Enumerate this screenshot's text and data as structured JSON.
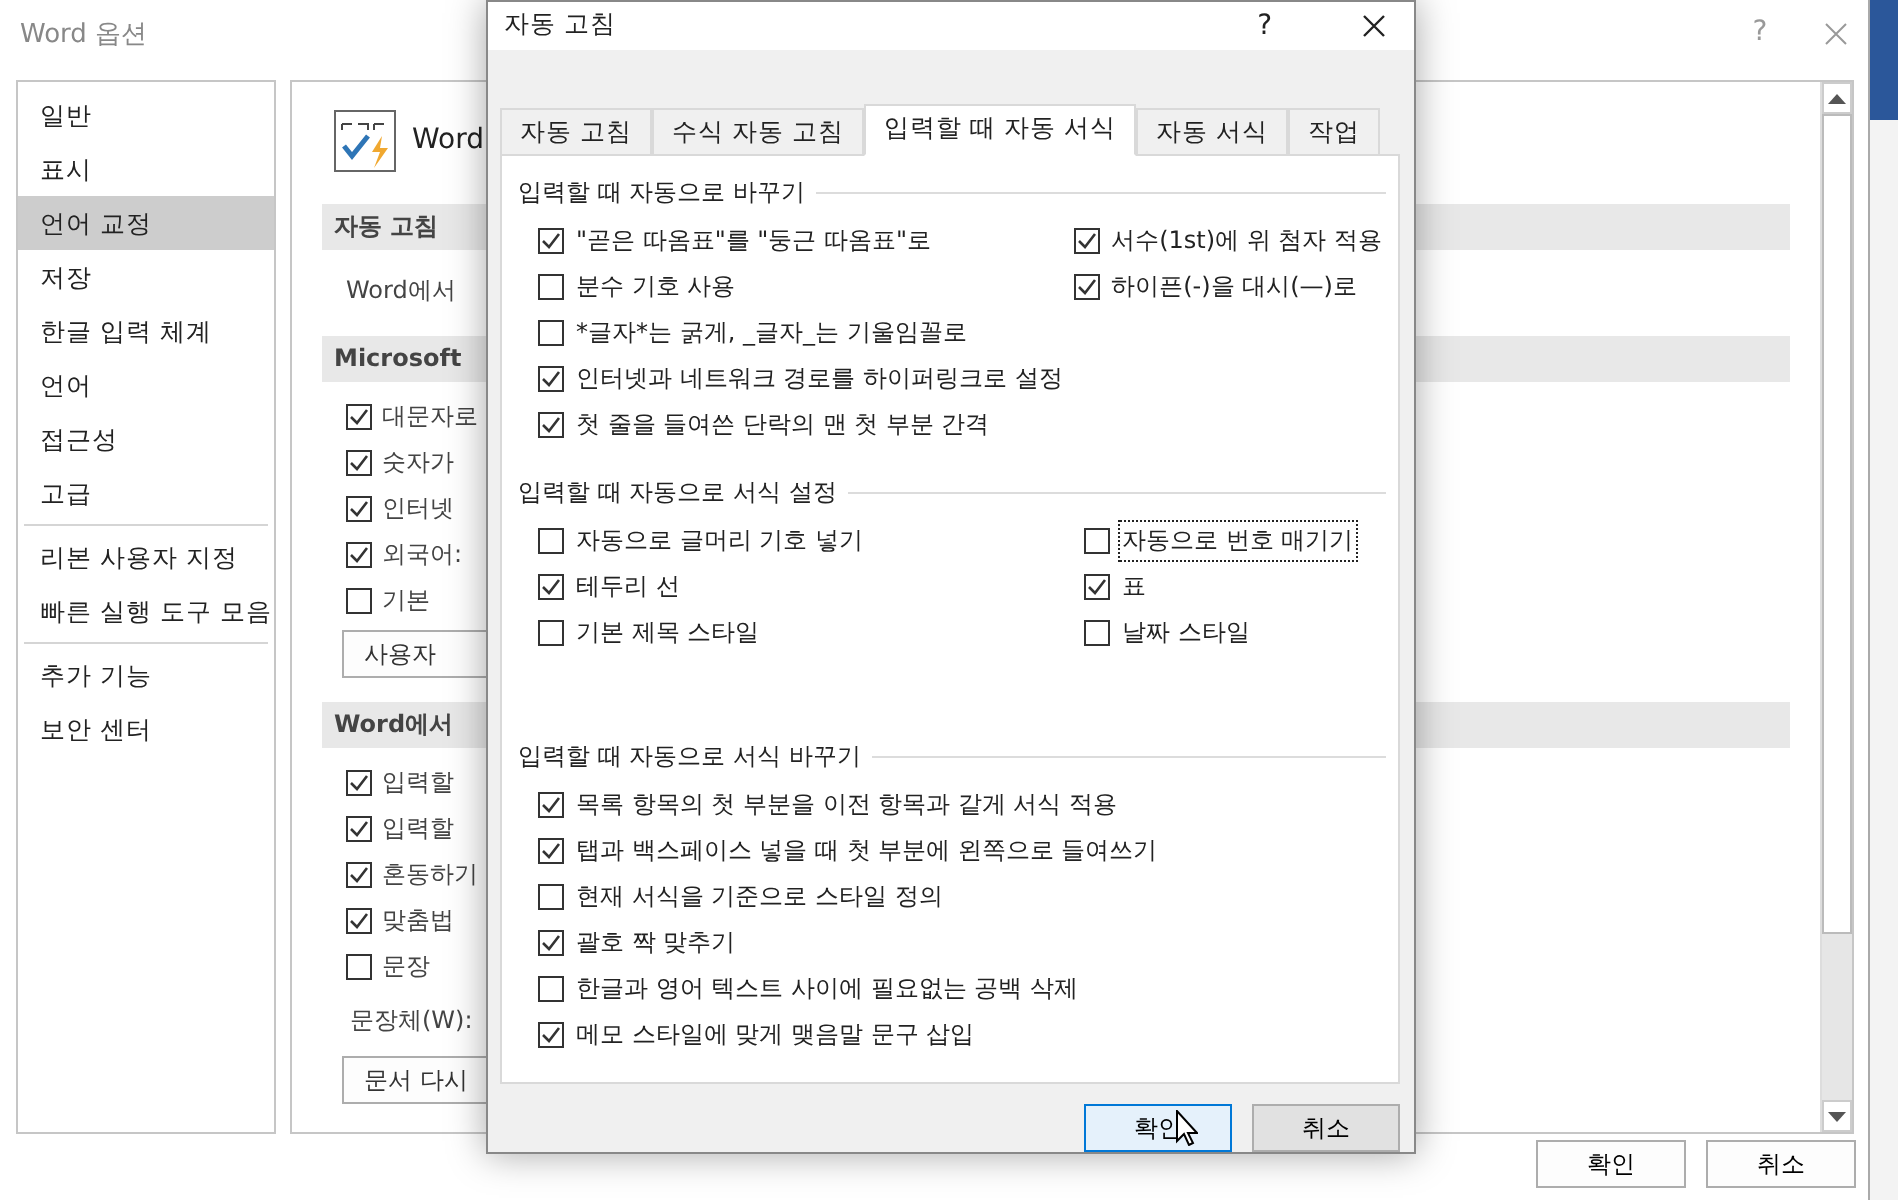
{
  "window": {
    "title": "Word 옵션",
    "help": "?"
  },
  "sidebar": {
    "groups": [
      {
        "items": [
          {
            "label": "일반",
            "selected": false
          },
          {
            "label": "표시",
            "selected": false
          },
          {
            "label": "언어 교정",
            "selected": true
          },
          {
            "label": "저장",
            "selected": false
          },
          {
            "label": "한글 입력 체계",
            "selected": false
          },
          {
            "label": "언어",
            "selected": false
          },
          {
            "label": "접근성",
            "selected": false
          },
          {
            "label": "고급",
            "selected": false
          }
        ]
      },
      {
        "items": [
          {
            "label": "리본 사용자 지정",
            "selected": false
          },
          {
            "label": "빠른 실행 도구 모음",
            "selected": false
          }
        ]
      },
      {
        "items": [
          {
            "label": "추가 기능",
            "selected": false
          },
          {
            "label": "보안 센터",
            "selected": false
          }
        ]
      }
    ]
  },
  "main": {
    "heading": "Word",
    "rows": [
      {
        "kind": "header",
        "text": "자동 고침"
      },
      {
        "kind": "text",
        "text": "Word에서"
      },
      {
        "kind": "header",
        "text": "Microsoft"
      },
      {
        "kind": "checkbox",
        "text": "대문자로",
        "checked": true
      },
      {
        "kind": "checkbox",
        "text": "숫자가",
        "checked": true
      },
      {
        "kind": "checkbox",
        "text": "인터넷",
        "checked": true
      },
      {
        "kind": "checkbox",
        "text": "외국어:",
        "checked": true
      },
      {
        "kind": "checkbox",
        "text": "기본",
        "checked": false
      },
      {
        "kind": "button",
        "text": "사용자"
      },
      {
        "kind": "header",
        "text": "Word에서"
      },
      {
        "kind": "checkbox",
        "text": "입력할",
        "checked": true
      },
      {
        "kind": "checkbox",
        "text": "입력할",
        "checked": true
      },
      {
        "kind": "checkbox",
        "text": "혼동하기",
        "checked": true
      },
      {
        "kind": "checkbox",
        "text": "맞춤법",
        "checked": true
      },
      {
        "kind": "checkbox",
        "text": "문장",
        "checked": false
      },
      {
        "kind": "field",
        "text": "문장체(W):"
      },
      {
        "kind": "button",
        "text": "문서 다시"
      }
    ]
  },
  "footer_buttons": [
    "확인",
    "취소"
  ],
  "dialog": {
    "title": "자동 고침",
    "help": "?",
    "tabs": [
      {
        "label": "자동 고침",
        "selected": false
      },
      {
        "label": "수식 자동 고침",
        "selected": false
      },
      {
        "label": "입력할 때 자동 서식",
        "selected": true
      },
      {
        "label": "자동 서식",
        "selected": false
      },
      {
        "label": "작업",
        "selected": false
      }
    ],
    "groups": [
      {
        "title": "입력할 때 자동으로 바꾸기",
        "columns": [
          [
            {
              "label": "\"곧은 따옴표\"를 \"둥근 따옴표\"로",
              "checked": true,
              "focused": false
            },
            {
              "label": "분수 기호 사용",
              "checked": false,
              "focused": false
            },
            {
              "label": "*글자*는 굵게, _글자_는 기울임꼴로",
              "checked": false,
              "focused": false
            },
            {
              "label": "인터넷과 네트워크 경로를 하이퍼링크로 설정",
              "checked": true,
              "focused": false
            },
            {
              "label": "첫 줄을 들여쓴 단락의 맨 첫 부분 간격",
              "checked": true,
              "focused": false
            }
          ],
          [
            {
              "label": "서수(1st)에 위 첨자 적용",
              "checked": true,
              "focused": false
            },
            {
              "label": "하이픈(-)을 대시(—)로",
              "checked": true,
              "focused": false
            }
          ]
        ]
      },
      {
        "title": "입력할 때 자동으로 서식 설정",
        "columns": [
          [
            {
              "label": "자동으로 글머리 기호 넣기",
              "checked": false,
              "focused": false
            },
            {
              "label": "테두리 선",
              "checked": true,
              "focused": false
            },
            {
              "label": "기본 제목 스타일",
              "checked": false,
              "focused": false
            }
          ],
          [
            {
              "label": "자동으로 번호 매기기",
              "checked": false,
              "focused": true
            },
            {
              "label": "표",
              "checked": true,
              "focused": false
            },
            {
              "label": "날짜 스타일",
              "checked": false,
              "focused": false
            }
          ]
        ]
      },
      {
        "title": "입력할 때 자동으로 서식 바꾸기",
        "columns": [
          [
            {
              "label": "목록 항목의 첫 부분을 이전 항목과 같게 서식 적용",
              "checked": true,
              "focused": false
            },
            {
              "label": "탭과 백스페이스 넣을 때 첫 부분에 왼쪽으로 들여쓰기",
              "checked": true,
              "focused": false
            },
            {
              "label": "현재 서식을 기준으로 스타일 정의",
              "checked": false,
              "focused": false
            },
            {
              "label": "괄호 짝 맞추기",
              "checked": true,
              "focused": false
            },
            {
              "label": "한글과 영어 텍스트 사이에 필요없는 공백 삭제",
              "checked": false,
              "focused": false
            },
            {
              "label": "메모 스타일에 맞게 맺음말 문구 삽입",
              "checked": true,
              "focused": false
            }
          ]
        ]
      }
    ],
    "buttons": [
      {
        "label": "확인",
        "default": true
      },
      {
        "label": "취소",
        "default": false
      }
    ]
  }
}
